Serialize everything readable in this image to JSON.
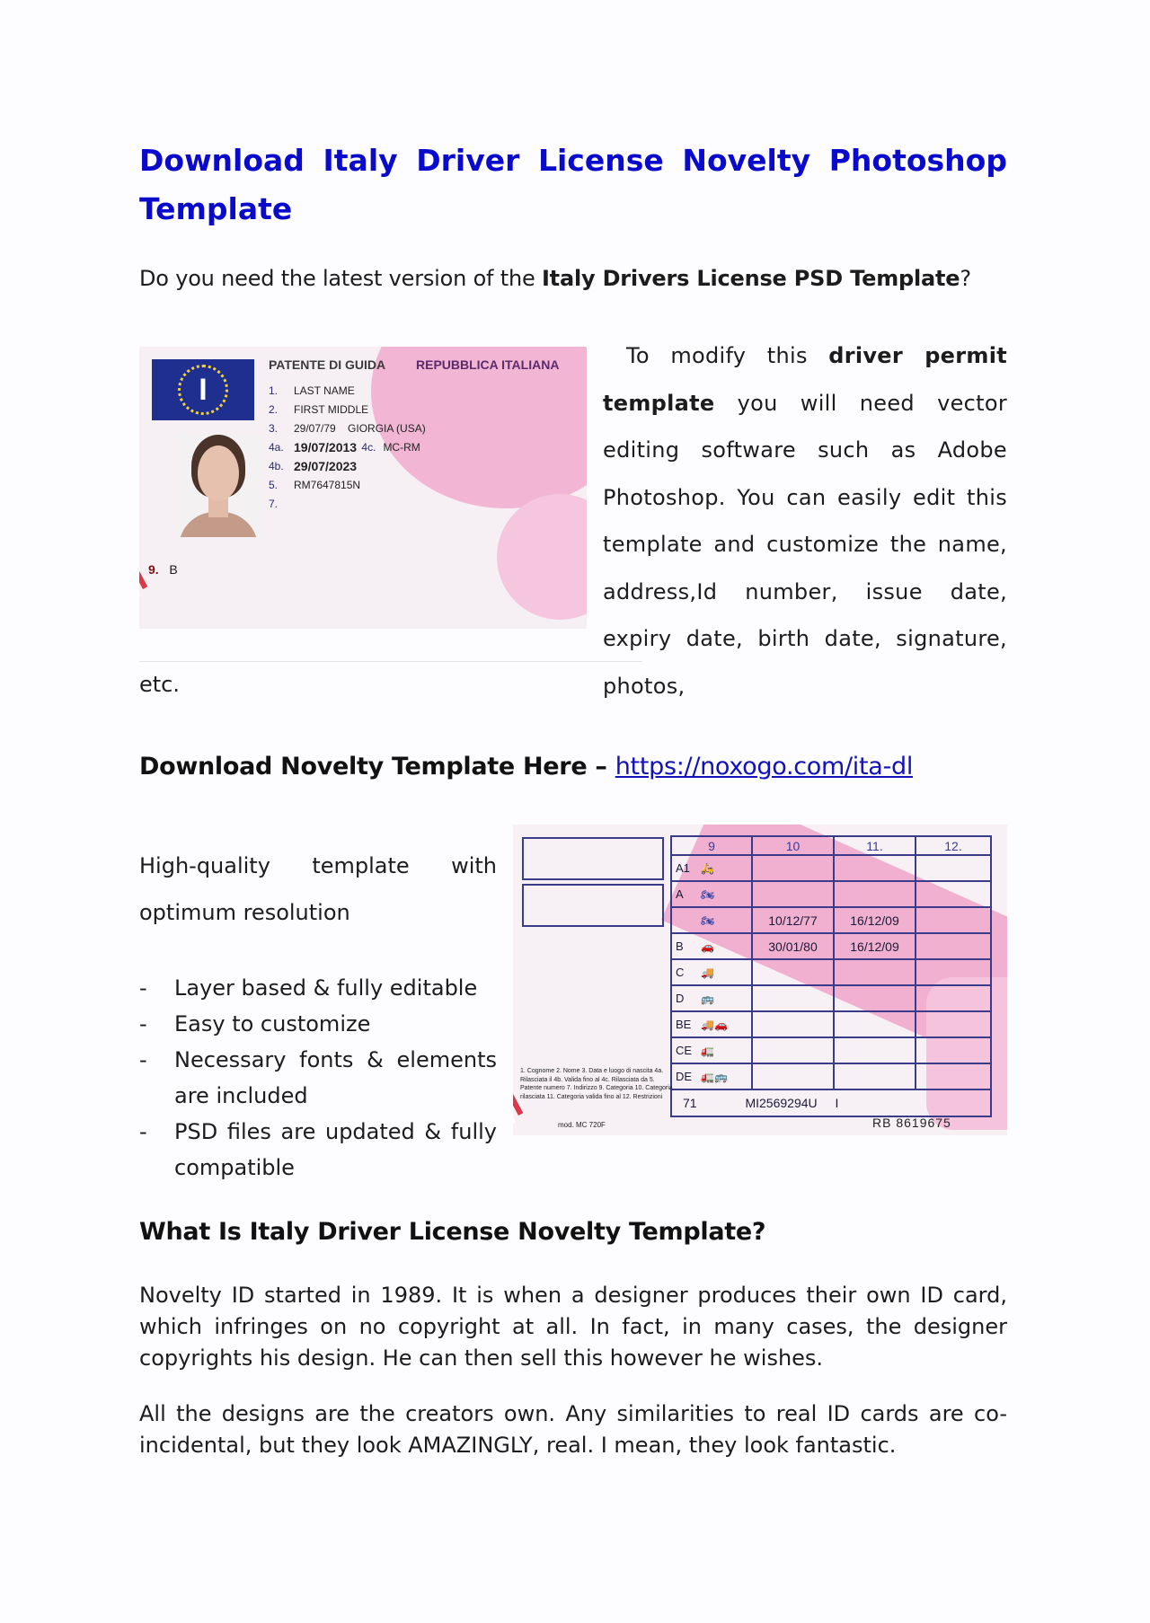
{
  "title": {
    "line1_words": [
      "Download",
      "Italy",
      "Driver",
      "License",
      "Novelty",
      "Photoshop"
    ],
    "line2": "Template"
  },
  "intro": {
    "prefix": "Do you need the latest version of the ",
    "bold": "Italy Drivers License PSD Template",
    "suffix": "?"
  },
  "front_card": {
    "country_code": "I",
    "heading_left": "PATENTE DI GUIDA",
    "heading_right": "REPUBBLICA ITALIANA",
    "fields": [
      {
        "num": "1.",
        "value": "LAST NAME"
      },
      {
        "num": "2.",
        "value": "FIRST MIDDLE"
      },
      {
        "num": "3.",
        "value": "29/07/79    GIORGIA (USA)"
      },
      {
        "num": "4a.",
        "value": "19/07/2013",
        "extra_num": "4c.",
        "extra": "MC-RM"
      },
      {
        "num": "4b.",
        "value": "29/07/2023"
      },
      {
        "num": "5.",
        "value": "RM7647815N"
      },
      {
        "num": "7.",
        "value": ""
      }
    ],
    "field9_num": "9.",
    "field9_value": "B"
  },
  "side_text": {
    "pre": "To modify this ",
    "bold": "driver permit template",
    "post": " you will need vector editing software such as Adobe Photoshop. You can easily edit this template and customize the name, address,Id number, issue date, expiry date, birth date, signature, photos,",
    "continuation": "etc."
  },
  "download": {
    "label": "Download Novelty Template Here – ",
    "link_text": "https://noxogo.com/ita-dl"
  },
  "features": {
    "intro_words": [
      "High-quality",
      "template",
      "with"
    ],
    "intro_line2": "optimum resolution",
    "bullets": [
      "Layer based & fully editable",
      "Easy to customize",
      "Necessary fonts & elements are included",
      "PSD files are updated & fully compatible"
    ],
    "bullet_marker": "-"
  },
  "back_card": {
    "headers": [
      "9",
      "10",
      "11.",
      "12."
    ],
    "rows": [
      {
        "code": "A1",
        "vehicle": "scooter-icon",
        "col10": "",
        "col11": ""
      },
      {
        "code": "A",
        "vehicle": "motorbike-icon",
        "col10": "",
        "col11": ""
      },
      {
        "code": "",
        "vehicle": "motorbike-icon",
        "col10": "10/12/77",
        "col11": "16/12/09"
      },
      {
        "code": "B",
        "vehicle": "car-icon",
        "col10": "30/01/80",
        "col11": "16/12/09"
      },
      {
        "code": "C",
        "vehicle": "truck-icon",
        "col10": "",
        "col11": ""
      },
      {
        "code": "D",
        "vehicle": "bus-icon",
        "col10": "",
        "col11": ""
      },
      {
        "code": "BE",
        "vehicle": "car-trailer-icon",
        "col10": "",
        "col11": ""
      },
      {
        "code": "CE",
        "vehicle": "truck-trailer-icon",
        "col10": "",
        "col11": ""
      },
      {
        "code": "DE",
        "vehicle": "bus-trailer-icon",
        "col10": "",
        "col11": ""
      }
    ],
    "bottom_code": "71",
    "bottom_number": "MI2569294U",
    "bottom_suffix": "I",
    "legend": "1. Cognome 2. Nome 3. Data e luogo di nascita 4a. Rilasciata il 4b. Valida fino al 4c. Rilasciata da 5. Patente numero 7. Indirizzo 9. Categoria 10. Categoria rilasciata 11. Categoria valida fino al 12. Restrizioni",
    "model": "mod. MC 720F",
    "serial": "RB 8619675"
  },
  "what_section": {
    "heading": "What Is Italy Driver License Novelty Template?",
    "paragraphs": [
      "Novelty ID started in 1989. It is when a designer produces their own ID card, which infringes on no copyright at all. In fact, in many cases, the designer copyrights his design. He can then sell this however he wishes.",
      "All the designs are the creators own. Any similarities to real ID cards are co-incidental, but they look AMAZINGLY, real. I mean, they look fantastic."
    ]
  },
  "colors": {
    "title_blue": "#0a0acc",
    "link_blue": "#1212b8",
    "card_pink": "#f2b5d3",
    "card_navy": "#3b3b8c"
  }
}
